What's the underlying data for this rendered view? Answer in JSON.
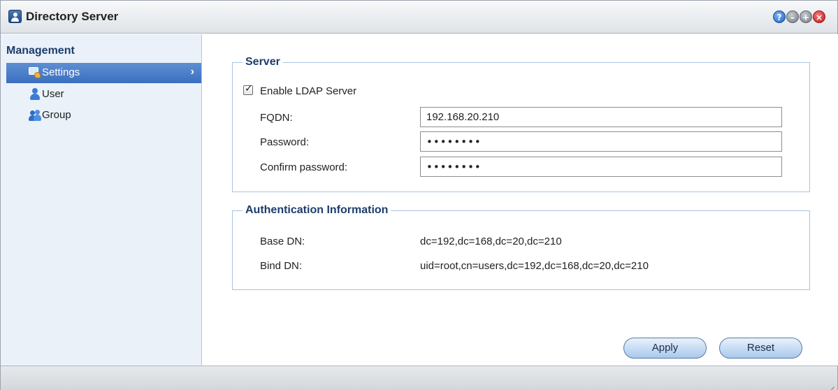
{
  "window": {
    "title": "Directory Server",
    "controls": [
      "help-icon",
      "minimize-icon",
      "maximize-icon",
      "close-icon"
    ]
  },
  "sidebar": {
    "heading": "Management",
    "items": [
      {
        "label": "Settings",
        "icon": "settings-icon",
        "active": true
      },
      {
        "label": "User",
        "icon": "user-icon",
        "active": false
      },
      {
        "label": "Group",
        "icon": "group-icon",
        "active": false
      }
    ]
  },
  "server": {
    "legend": "Server",
    "enable_ldap_label": "Enable LDAP Server",
    "enable_ldap_checked": true,
    "fqdn_label": "FQDN:",
    "fqdn_value": "192.168.20.210",
    "password_label": "Password:",
    "password_value": "••••••••",
    "confirm_label": "Confirm password:",
    "confirm_value": "••••••••"
  },
  "auth": {
    "legend": "Authentication Information",
    "base_dn_label": "Base DN:",
    "base_dn_value": "dc=192,dc=168,dc=20,dc=210",
    "bind_dn_label": "Bind DN:",
    "bind_dn_value": "uid=root,cn=users,dc=192,dc=168,dc=20,dc=210"
  },
  "buttons": {
    "apply": "Apply",
    "reset": "Reset"
  },
  "colors": {
    "accent": "#3a6fbf",
    "sidebar_bg": "#eaf1f9",
    "heading": "#1d3d6b",
    "close": "#c41818"
  }
}
